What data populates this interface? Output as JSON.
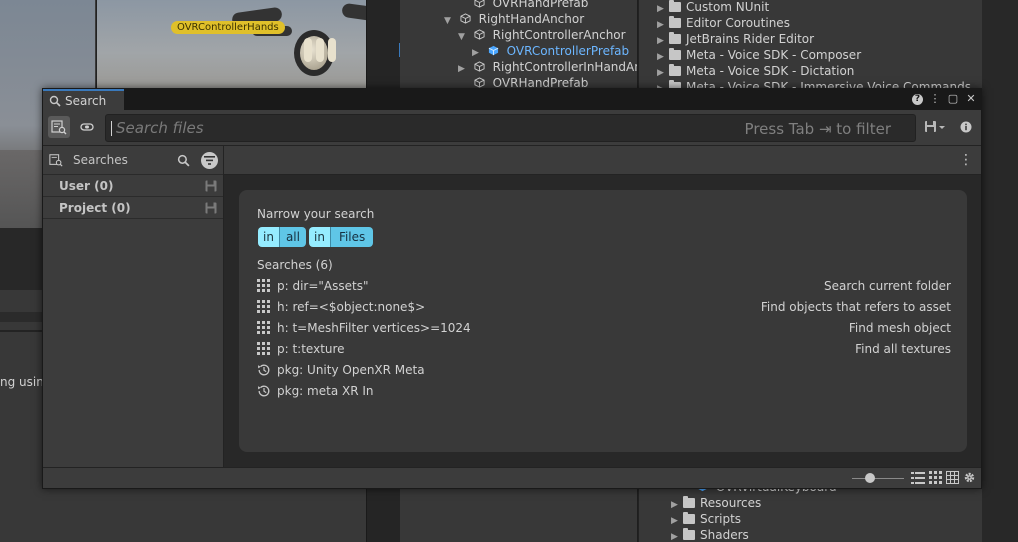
{
  "scene": {
    "object_label": "OVRControllerHands",
    "clipped_text": "ng using"
  },
  "hierarchy": {
    "rows": [
      {
        "label": "OVRHandPrefab",
        "expand": ""
      },
      {
        "label": "RightHandAnchor",
        "expand": "▼"
      },
      {
        "label": "RightControllerAnchor",
        "expand": "▼"
      },
      {
        "label": "OVRControllerPrefab",
        "expand": "▶"
      },
      {
        "label": "RightControllerInHandAnchor",
        "expand": "▶"
      },
      {
        "label": "OVRHandPrefab",
        "expand": ""
      }
    ]
  },
  "project": {
    "top_folders": [
      "Custom NUnit",
      "Editor Coroutines",
      "JetBrains Rider Editor",
      "Meta - Voice SDK - Composer",
      "Meta - Voice SDK - Dictation",
      "Meta - Voice SDK - Immersive Voice Commands"
    ],
    "bottom_prefab": "OVRVirtualKeyboard",
    "bottom_folders": [
      "Resources",
      "Scripts",
      "Shaders"
    ]
  },
  "window": {
    "tab_title": "Search",
    "help_label": "?",
    "menu_label": "⋮",
    "maximize_label": "▢",
    "close_label": "✕"
  },
  "search": {
    "placeholder": "Search files",
    "hint": "Press Tab ⇥ to filter"
  },
  "sidebar": {
    "header": "Searches",
    "items": [
      {
        "label": "User (0)"
      },
      {
        "label": "Project (0)"
      }
    ]
  },
  "main": {
    "narrow_title": "Narrow your search",
    "chips": [
      {
        "key": "in",
        "value": "all"
      },
      {
        "key": "in",
        "value": "Files"
      }
    ],
    "searches_title": "Searches (6)",
    "queries": [
      {
        "icon": "grid-icon",
        "query": "p: dir=\"Assets\"",
        "description": "Search current folder"
      },
      {
        "icon": "grid-icon",
        "query": "h: ref=<$object:none$>",
        "description": "Find objects that refers to asset"
      },
      {
        "icon": "grid-icon",
        "query": "h: t=MeshFilter vertices>=1024",
        "description": "Find mesh object"
      },
      {
        "icon": "grid-icon",
        "query": "p: t:texture",
        "description": "Find all textures"
      },
      {
        "icon": "history-icon",
        "query": "pkg: Unity OpenXR Meta",
        "description": ""
      },
      {
        "icon": "history-icon",
        "query": "pkg: meta XR In",
        "description": ""
      }
    ]
  },
  "statusbar": {
    "icon_size_fraction": 0.35
  }
}
